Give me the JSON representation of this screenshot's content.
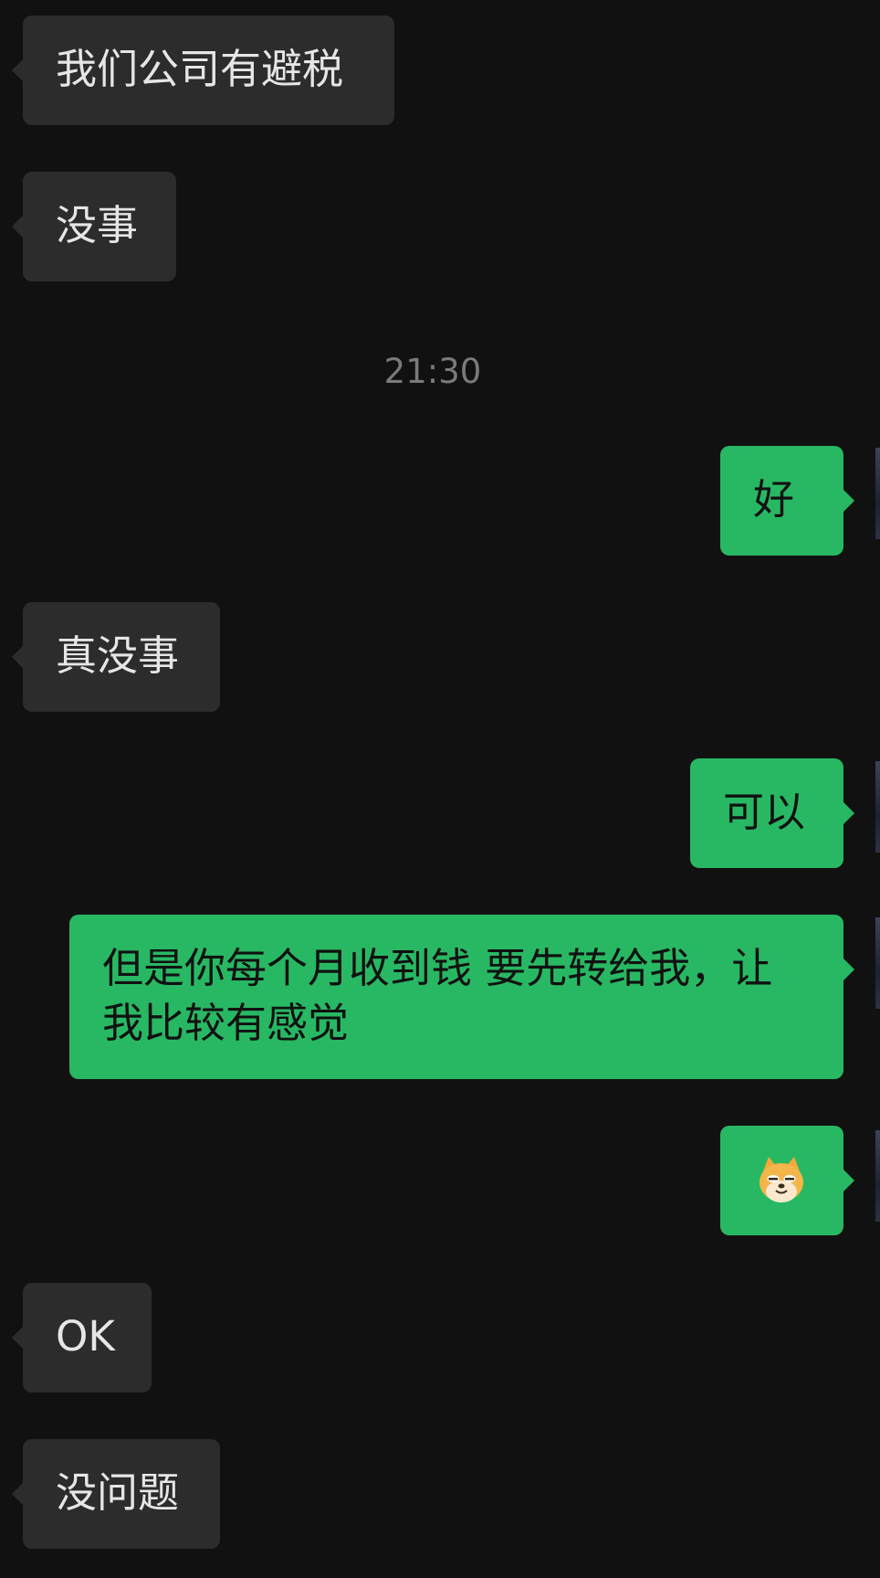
{
  "messages": [
    {
      "side": "in",
      "text": "我们公司有避税"
    },
    {
      "side": "in",
      "text": "没事"
    },
    {
      "side": "out",
      "text": "好"
    },
    {
      "side": "in",
      "text": "真没事"
    },
    {
      "side": "out",
      "text": "可以"
    },
    {
      "side": "out",
      "text": "但是你每个月收到钱 要先转给我，让\n我比较有感觉"
    },
    {
      "side": "out",
      "emoji": "doge-sticker-icon"
    },
    {
      "side": "in",
      "text": "OK"
    },
    {
      "side": "in",
      "text": "没问题"
    }
  ],
  "timestamp": "21:30",
  "colors": {
    "background": "#111111",
    "incoming_bubble": "#2c2c2c",
    "outgoing_bubble": "#28b863",
    "timestamp_text": "#7a7a7a"
  }
}
